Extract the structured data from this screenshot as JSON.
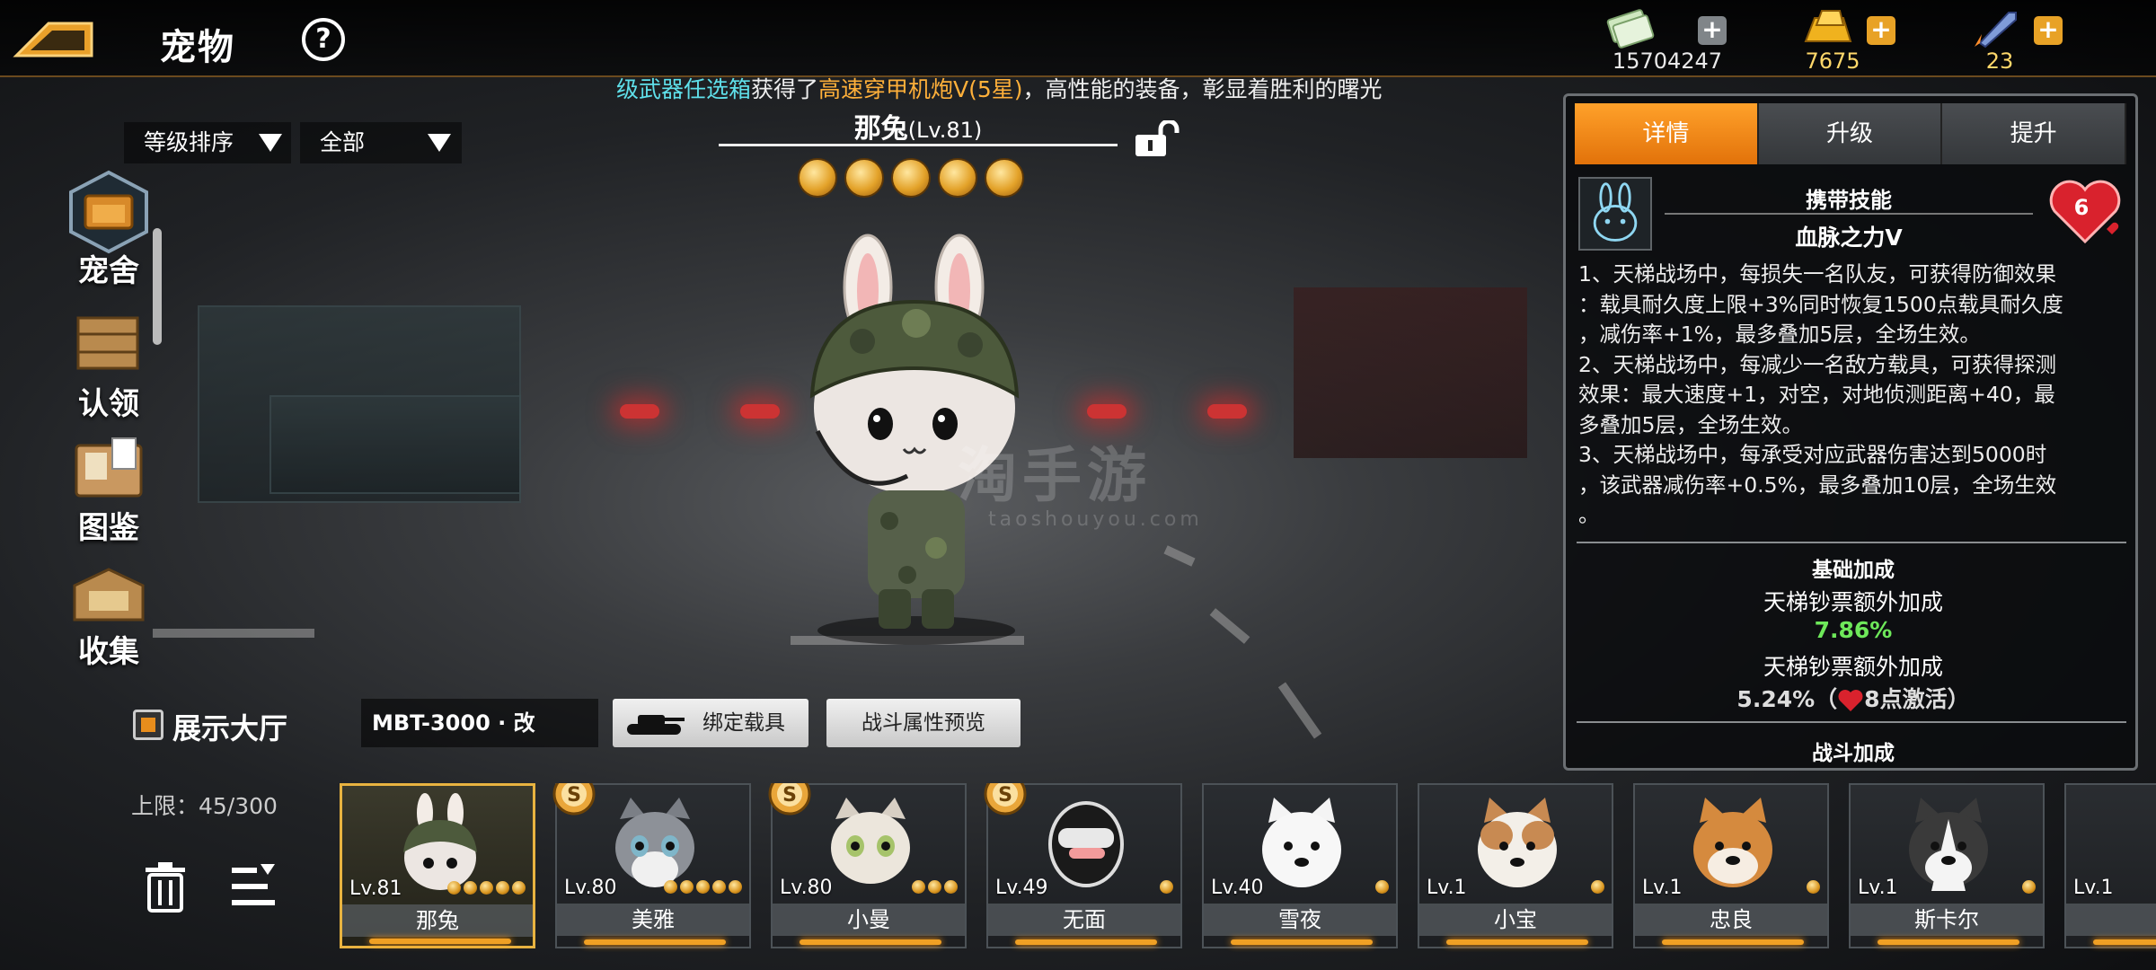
{
  "header": {
    "title": "宠物",
    "help_glyph": "?",
    "resources": [
      {
        "icon": "cash-icon",
        "value": "15704247",
        "plus": "+"
      },
      {
        "icon": "gold-bar-icon",
        "value": "7675",
        "plus": "+"
      },
      {
        "icon": "rocket-icon",
        "value": "23",
        "plus": "+"
      }
    ]
  },
  "marquee": {
    "part1": "级武器任选箱",
    "part2": "获得了",
    "part3": "高速穿甲机炮V(5星)",
    "part4": "，高性能的装备，彰显着胜利的曙光"
  },
  "filters": {
    "sort": "等级排序",
    "scope": "全部"
  },
  "nav": [
    {
      "label": "宠舍",
      "icon": "kennel-icon"
    },
    {
      "label": "认领",
      "icon": "crate-icon"
    },
    {
      "label": "图鉴",
      "icon": "book-icon"
    },
    {
      "label": "收集",
      "icon": "collection-box-icon"
    }
  ],
  "pet": {
    "name": "那兔",
    "level": "(Lv.81)",
    "stars": 5
  },
  "watermark": {
    "main": "淘手游",
    "sub": "taoshouyou.com"
  },
  "bottom": {
    "hall_label": "展示大厅",
    "vehicle": "MBT-3000 · 改",
    "bind_btn": "绑定载具",
    "preview_btn": "战斗属性预览",
    "limit": "上限：45/300"
  },
  "cards": [
    {
      "name": "那兔",
      "level": "Lv.81",
      "stars": 5,
      "badge": false,
      "selected": true
    },
    {
      "name": "美雅",
      "level": "Lv.80",
      "stars": 5,
      "badge": true,
      "selected": false
    },
    {
      "name": "小曼",
      "level": "Lv.80",
      "stars": 3,
      "badge": true,
      "selected": false
    },
    {
      "name": "无面",
      "level": "Lv.49",
      "stars": 1,
      "badge": true,
      "selected": false
    },
    {
      "name": "雪夜",
      "level": "Lv.40",
      "stars": 1,
      "badge": false,
      "selected": false
    },
    {
      "name": "小宝",
      "level": "Lv.1",
      "stars": 1,
      "badge": false,
      "selected": false
    },
    {
      "name": "忠良",
      "level": "Lv.1",
      "stars": 1,
      "badge": false,
      "selected": false
    },
    {
      "name": "斯卡尔",
      "level": "Lv.1",
      "stars": 1,
      "badge": false,
      "selected": false
    },
    {
      "name": "",
      "level": "Lv.1",
      "stars": 0,
      "badge": false,
      "selected": false
    }
  ],
  "panel": {
    "tabs": [
      "详情",
      "升级",
      "提升"
    ],
    "skill_header": "携带技能",
    "skill_name": "血脉之力Ⅴ",
    "heart_count": "6",
    "description": [
      "1、天梯战场中，每损失一名队友，可获得防御效果",
      "：载具耐久度上限+3%同时恢复1500点载具耐久度",
      "，减伤率+1%，最多叠加5层，全场生效。",
      "2、天梯战场中，每减少一名敌方载具，可获得探测",
      "效果：最大速度+1，对空，对地侦测距离+40，最",
      "多叠加5层，全场生效。",
      "3、天梯战场中，每承受对应武器伤害达到5000时",
      "，该武器减伤率+0.5%，最多叠加10层，全场生效",
      "。"
    ],
    "base_title": "基础加成",
    "bonus1_label": "天梯钞票额外加成",
    "bonus1_value": "7.86%",
    "bonus2_label": "天梯钞票额外加成",
    "bonus2_value": "5.24%",
    "bonus2_paren_open": "（",
    "bonus2_note": "8点激活）",
    "combat_title": "战斗加成"
  }
}
